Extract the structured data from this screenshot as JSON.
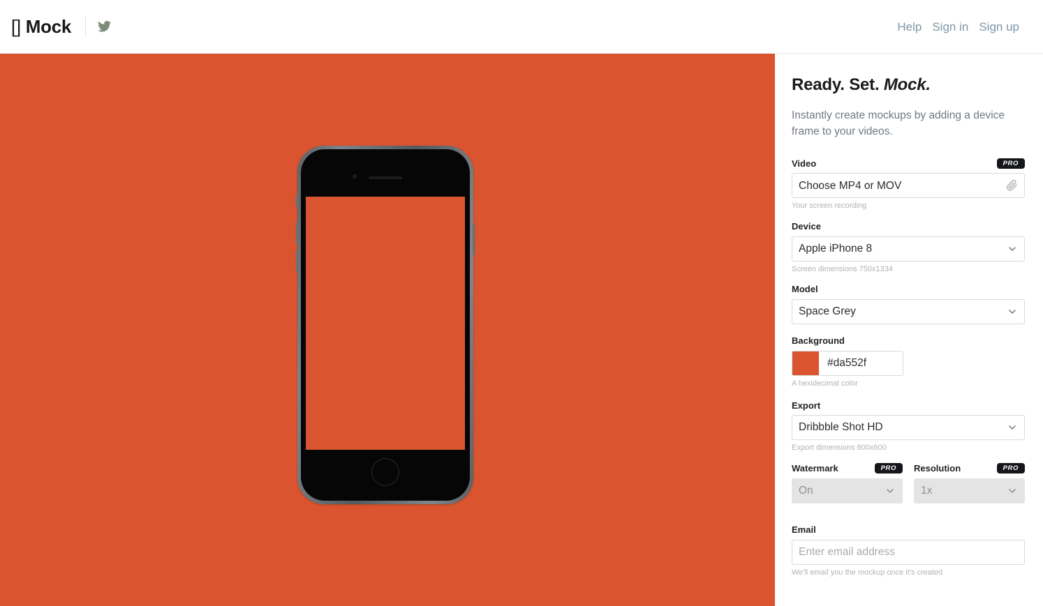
{
  "header": {
    "logo_brackets": "[]",
    "logo_text": "Mock",
    "twitter_icon": "twitter-bird-icon",
    "nav": [
      {
        "label": "Help"
      },
      {
        "label": "Sign in"
      },
      {
        "label": "Sign up"
      }
    ]
  },
  "canvas": {
    "background_color": "#da552f",
    "device_preview": "apple-iphone-8-space-grey",
    "screen_color": "#da552f"
  },
  "panel": {
    "title_plain": "Ready. Set. ",
    "title_italic": "Mock.",
    "subtitle": "Instantly create mockups by adding a device frame to your videos.",
    "fields": {
      "video": {
        "label": "Video",
        "badge": "PRO",
        "value": "Choose MP4 or MOV",
        "icon": "paperclip-icon",
        "helper": "Your screen recording"
      },
      "device": {
        "label": "Device",
        "value": "Apple iPhone 8",
        "icon": "chevron-down-icon",
        "helper": "Screen dimensions 750x1334"
      },
      "model": {
        "label": "Model",
        "value": "Space Grey",
        "icon": "chevron-down-icon"
      },
      "background": {
        "label": "Background",
        "value": "#da552f",
        "swatch_color": "#da552f",
        "helper": "A hexidecimal color"
      },
      "export": {
        "label": "Export",
        "value": "Dribbble Shot HD",
        "icon": "chevron-down-icon",
        "helper": "Export dimensions 800x600"
      },
      "watermark": {
        "label": "Watermark",
        "badge": "PRO",
        "value": "On",
        "icon": "chevron-down-icon",
        "disabled": true
      },
      "resolution": {
        "label": "Resolution",
        "badge": "PRO",
        "value": "1x",
        "icon": "chevron-down-icon",
        "disabled": true
      },
      "email": {
        "label": "Email",
        "placeholder": "Enter email address",
        "value": "",
        "helper": "We'll email you the mockup once it's created"
      }
    }
  }
}
